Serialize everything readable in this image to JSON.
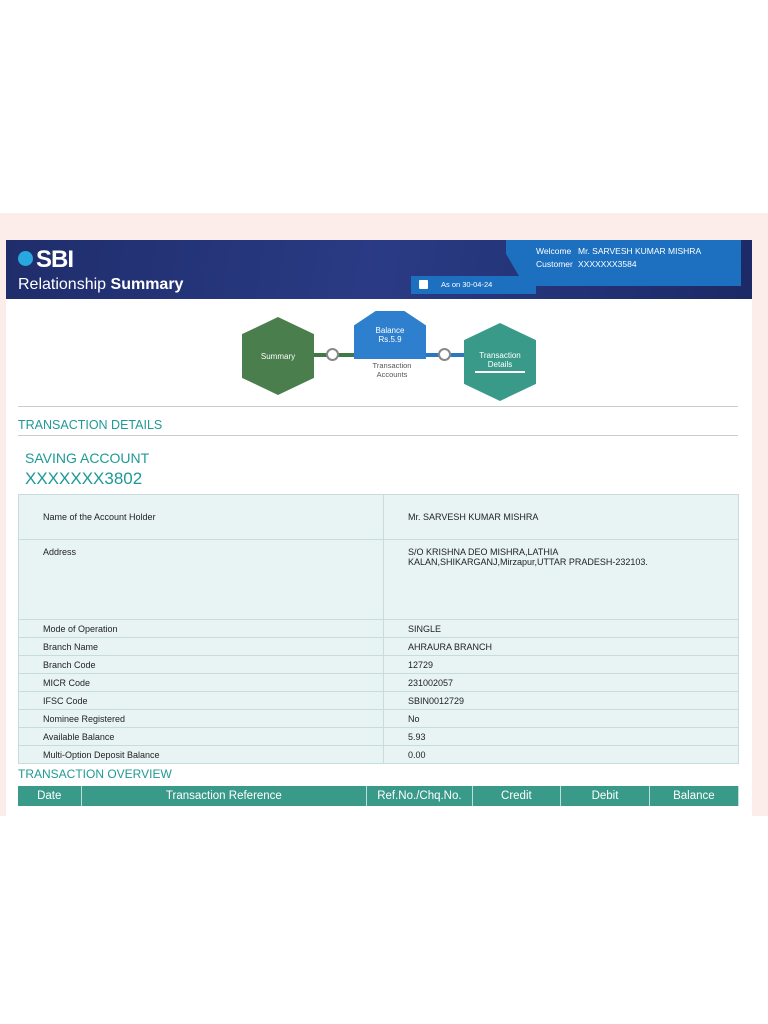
{
  "header": {
    "logo": "SBI",
    "title_light": "Relationship",
    "title_bold": "Summary",
    "welcome_label": "Welcome",
    "welcome_name": "Mr. SARVESH KUMAR MISHRA",
    "customer_label": "Customer",
    "customer_id": "XXXXXXX3584",
    "as_on": "As on 30-04-24"
  },
  "flow": {
    "summary": "Summary",
    "balance_label": "Balance",
    "balance_value": "Rs.5.9",
    "transaction_accounts": "Transaction Accounts",
    "transaction_details": "Transaction Details"
  },
  "section_title": "TRANSACTION DETAILS",
  "account": {
    "type": "SAVING ACCOUNT",
    "number": "XXXXXXX3802"
  },
  "details": [
    {
      "label": "Name of the Account Holder",
      "value": "Mr. SARVESH KUMAR MISHRA"
    },
    {
      "label": "Address",
      "value": "S/O KRISHNA DEO MISHRA,LATHIA KALAN,SHIKARGANJ,Mirzapur,UTTAR PRADESH-232103."
    },
    {
      "label": "Mode of Operation",
      "value": "SINGLE"
    },
    {
      "label": "Branch Name",
      "value": "AHRAURA BRANCH"
    },
    {
      "label": "Branch Code",
      "value": "12729"
    },
    {
      "label": "MICR Code",
      "value": "231002057"
    },
    {
      "label": "IFSC Code",
      "value": "SBIN0012729"
    },
    {
      "label": "Nominee Registered",
      "value": "No"
    },
    {
      "label": "Available Balance",
      "value": "5.93"
    },
    {
      "label": "Multi-Option Deposit Balance",
      "value": "0.00"
    }
  ],
  "overview": {
    "title": "TRANSACTION OVERVIEW",
    "columns": [
      "Date",
      "Transaction Reference",
      "Ref.No./Chq.No.",
      "Credit",
      "Debit",
      "Balance"
    ]
  }
}
